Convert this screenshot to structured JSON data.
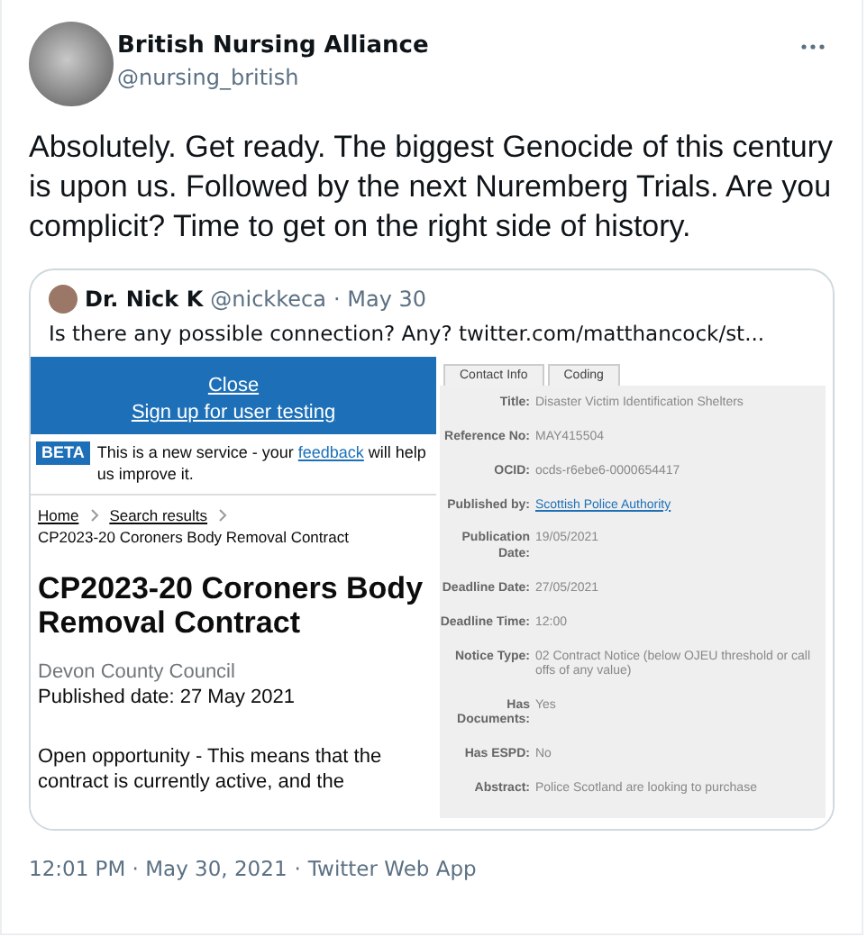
{
  "author": {
    "name": "British Nursing Alliance",
    "handle": "@nursing_british"
  },
  "text": "Absolutely. Get ready.  The biggest Genocide of this century is upon us. Followed by the next Nuremberg Trials. Are you complicit? Time to get on the right side of history.",
  "quote": {
    "name": "Dr. Nick K",
    "handle": "@nickkeca",
    "date": "· May 30",
    "text": "Is there any possible connection? Any?  twitter.com/matthancock/st...",
    "left": {
      "links": [
        "Close",
        "Sign up for user testing"
      ],
      "beta": {
        "tag": "BETA",
        "before": "This is a new service - your ",
        "link": "feedback",
        "after": " will help us improve it."
      },
      "breadcrumbs": [
        {
          "label": "Home",
          "kind": "link"
        },
        {
          "label": "Search results",
          "kind": "link"
        },
        {
          "label": "CP2023-20 Coroners Body Removal Contract",
          "kind": "current"
        }
      ],
      "title": "CP2023-20 Coroners Body Removal Contract",
      "org": "Devon County Council",
      "published": "Published date: 27 May 2021",
      "summary": "Open opportunity - This means that the contract is currently active, and the"
    },
    "right": {
      "tabs": [
        {
          "label": "Contact Info",
          "selected": false
        },
        {
          "label": "Coding",
          "selected": false
        }
      ],
      "fields": [
        {
          "label": "Title:",
          "value": "Disaster Victim Identification Shelters",
          "kind": "text"
        },
        {
          "label": "Reference No:",
          "value": "MAY415504",
          "kind": "text"
        },
        {
          "label": "OCID:",
          "value": "ocds-r6ebe6-0000654417",
          "kind": "text"
        },
        {
          "label": "Published by:",
          "value": "Scottish Police Authority",
          "kind": "link"
        },
        {
          "label": "Publication Date:",
          "value": "19/05/2021",
          "kind": "text"
        },
        {
          "label": "Deadline Date:",
          "value": "27/05/2021",
          "kind": "text"
        },
        {
          "label": "Deadline Time:",
          "value": "12:00",
          "kind": "text"
        },
        {
          "label": "Notice Type:",
          "value": "02 Contract Notice (below OJEU threshold or call offs of any value)",
          "kind": "text"
        },
        {
          "label": "Has Documents:",
          "value": "Yes",
          "kind": "text"
        },
        {
          "label": "Has ESPD:",
          "value": "No",
          "kind": "text"
        },
        {
          "label": "Abstract:",
          "value": "Police Scotland are looking to purchase",
          "kind": "text"
        }
      ]
    }
  },
  "meta": {
    "time": "12:01 PM · May 30, 2021",
    "separator": "·",
    "source": "Twitter Web App"
  }
}
